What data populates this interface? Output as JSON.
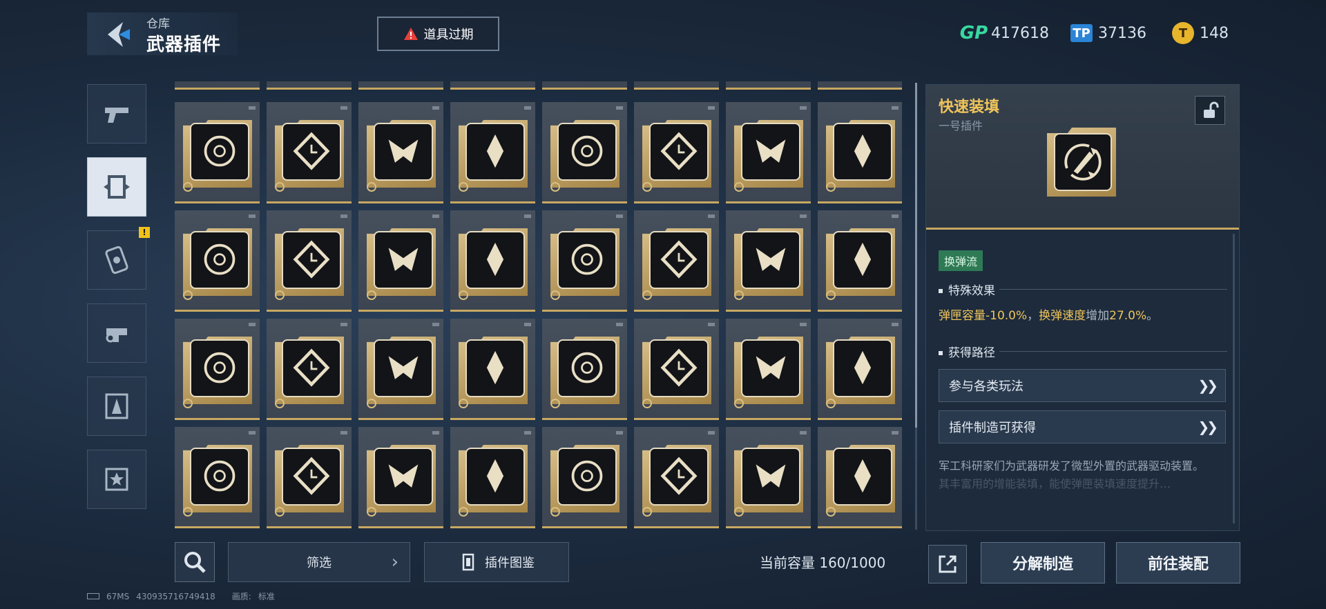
{
  "header": {
    "breadcrumb": "仓库",
    "title": "武器插件",
    "expired_label": "道具过期"
  },
  "currencies": [
    {
      "icon": "gp-icon",
      "symbol": "GP",
      "value": "417618",
      "color": "#38d9a0"
    },
    {
      "icon": "tp-ticket-icon",
      "symbol": "TP",
      "value": "37136",
      "color": "#2b84d6"
    },
    {
      "icon": "gold-coin-icon",
      "symbol": "T",
      "value": "148",
      "color": "#e7b52c"
    }
  ],
  "categories": [
    {
      "icon": "pistol-icon",
      "active": false,
      "badge": ""
    },
    {
      "icon": "plugin-icon",
      "active": true,
      "badge": ""
    },
    {
      "icon": "chip-icon",
      "active": false,
      "badge": "!"
    },
    {
      "icon": "grenade-launcher-icon",
      "active": false,
      "badge": ""
    },
    {
      "icon": "character-icon",
      "active": false,
      "badge": ""
    },
    {
      "icon": "star-badge-icon",
      "active": false,
      "badge": ""
    }
  ],
  "grid": {
    "rows": [
      [
        "crosshair-icon",
        "diamond-clock-icon",
        "split-burst-icon",
        "converge-arrows-icon",
        "rocket-left-icon",
        "rocket-left-icon",
        "dotted-ring-icon",
        "chevron-up-icon"
      ],
      [
        "chevron-up-icon",
        "rapid-fire-icon",
        "target-up-icon",
        "drop-shock-icon",
        "shield-star-icon",
        "shield-star-icon",
        "flame-icon",
        "dragon-head-icon"
      ],
      [
        "spiked-orb-icon",
        "explosion-icon",
        "slash-orb-icon",
        "mushroom-cloud-icon",
        "lightning-icon",
        "ring-nodes-icon",
        "skull-horns-icon",
        "demon-mask-icon"
      ],
      [
        "yin-swirl-icon",
        "yin-swirl-icon",
        "comet-icon",
        "fist-icon",
        "bull-skull-icon",
        "bull-skull-icon",
        "crossed-stars-icon",
        "crossed-stars-icon"
      ]
    ]
  },
  "detail": {
    "name": "快速装填",
    "slot": "一号插件",
    "tag": "换弹流",
    "effect_title": "特殊效果",
    "effect": {
      "part1": "弹匣容量-10.0%",
      "sep": "，",
      "part2": "换弹速度",
      "part3": "增加",
      "part4": "27.0%",
      "end": "。"
    },
    "source_title": "获得路径",
    "sources": [
      "参与各类玩法",
      "插件制造可获得"
    ],
    "description": "军工科研家们为武器研发了微型外置的武器驱动装置。",
    "description_more": "其丰富用的增能装填，能使弹匣装填速度提升…"
  },
  "bottom": {
    "filter_label": "筛选",
    "codex_label": "插件图鉴",
    "capacity_label": "当前容量",
    "capacity_value": "160/1000",
    "dismantle_label": "分解制造",
    "goto_label": "前往装配"
  },
  "status": {
    "ping": "67MS",
    "uid": "430935716749418",
    "quality_label": "画质:",
    "quality_value": "标准"
  }
}
